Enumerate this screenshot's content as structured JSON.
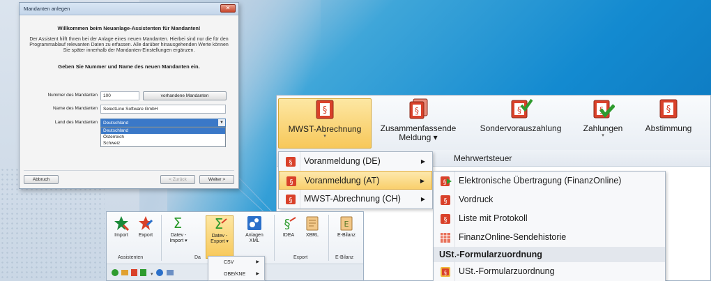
{
  "wizard": {
    "title": "Mandanten anlegen",
    "close": "✕",
    "heading": "Willkommen beim Neuanlage-Assistenten für Mandanten!",
    "intro": "Der Assistent hilft Ihnen bei der Anlage eines neuen Mandanten. Hierbei sind nur die für den Programmablauf relevanten Daten zu erfassen. Alle darüber hinausgehenden Werte können Sie später innerhalb der Mandanten-Einstellungen ergänzen.",
    "subheading": "Geben Sie Nummer und Name des neuen Mandanten ein.",
    "number_label": "Nummer des Mandanten",
    "number_value": "100",
    "existing_button": "vorhandene Mandanten",
    "name_label": "Name des Mandanten",
    "name_value": "SelectLine Software GmbH",
    "country_label": "Land des Mandanten",
    "country_value": "Deutschland",
    "country_options": [
      "Deutschland",
      "Österreich",
      "Schweiz"
    ],
    "cancel_button": "Abbruch",
    "back_button": "< Zurück",
    "next_button": "Weiter >"
  },
  "ribbon": {
    "buttons": [
      {
        "label": "MWST-Abrechnung",
        "label2": "",
        "chevron": "▾"
      },
      {
        "label": "Zusammenfassende",
        "label2": "Meldung ▾",
        "chevron": ""
      },
      {
        "label": "Sondervorauszahlung",
        "label2": "",
        "chevron": ""
      },
      {
        "label": "Zahlungen",
        "label2": "",
        "chevron": "▾"
      },
      {
        "label": "Abstimmung",
        "label2": "",
        "chevron": ""
      }
    ],
    "group_label": "Mehrwertsteuer"
  },
  "menu1": {
    "items": [
      "Voranmeldung (DE)",
      "Voranmeldung (AT)",
      "MWST-Abrechnung (CH)"
    ],
    "arrow": "▶"
  },
  "menu2": {
    "items": [
      "Elektronische Übertragung (FinanzOnline)",
      "Vordruck",
      "Liste mit Protokoll",
      "FinanzOnline-Sendehistorie"
    ],
    "header": "USt.-Formularzuordnung",
    "last_item": "USt.-Formularzuordnung"
  },
  "small_ribbon": {
    "buttons": [
      {
        "l1": "Import",
        "l2": ""
      },
      {
        "l1": "Export",
        "l2": ""
      },
      {
        "l1": "Datev -",
        "l2": "Import ▾"
      },
      {
        "l1": "Datev -",
        "l2": "Export ▾"
      },
      {
        "l1": "Anlagen",
        "l2": "XML"
      },
      {
        "l1": "IDEA",
        "l2": ""
      },
      {
        "l1": "XBRL",
        "l2": ""
      },
      {
        "l1": "E-Bilanz",
        "l2": ""
      }
    ],
    "groups": [
      "Assistenten",
      "Da",
      "Export",
      "E-Bilanz"
    ],
    "menu": [
      "CSV",
      "OBE/KNE"
    ],
    "arrow": "▶"
  },
  "colors": {
    "accent_blue": "#138ad0",
    "active_ribbon": "#f7c85a",
    "icon_red": "#d9412a",
    "icon_green": "#2e9b2e"
  }
}
